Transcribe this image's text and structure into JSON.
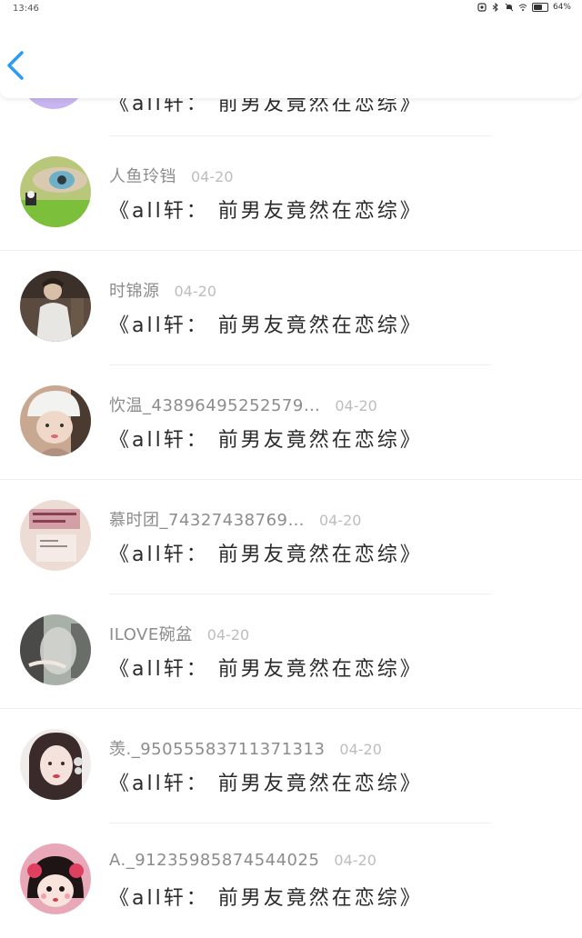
{
  "status_bar": {
    "time": "13:46",
    "battery_percent": 64,
    "battery_label": "64%",
    "icons": [
      "notification-icon",
      "bluetooth-icon",
      "mute-icon",
      "wifi-icon",
      "battery-icon"
    ]
  },
  "header": {
    "back_icon": "chevron-left-icon",
    "accent_color": "#2a9bf5"
  },
  "partial_row": {
    "msg": "《all轩：  前男友竟然在恋综》"
  },
  "rows": [
    {
      "name": "人鱼玲铛",
      "date": "04-20",
      "msg": "《all轩：  前男友竟然在恋综》"
    },
    {
      "name": "时锦源",
      "date": "04-20",
      "msg": "《all轩：  前男友竟然在恋综》"
    },
    {
      "name": "忺温_43896495252579…",
      "date": "04-20",
      "msg": "《all轩：  前男友竟然在恋综》"
    },
    {
      "name": "慕时团_74327438769…",
      "date": "04-20",
      "msg": "《all轩：  前男友竟然在恋综》"
    },
    {
      "name": "ILOVE碗盆",
      "date": "04-20",
      "msg": "《all轩：  前男友竟然在恋综》"
    },
    {
      "name": "羡._95055583711371313",
      "date": "04-20",
      "msg": "《all轩：  前男友竟然在恋综》"
    },
    {
      "name": "A._91235985874544025",
      "date": "04-20",
      "msg": "《all轩：  前男友竟然在恋综》"
    }
  ]
}
